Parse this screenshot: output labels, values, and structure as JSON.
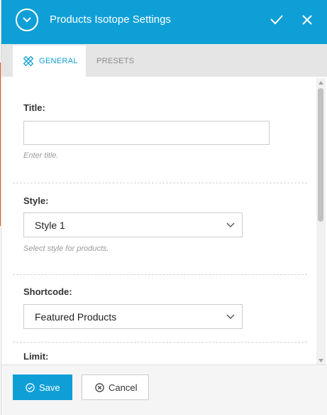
{
  "modal": {
    "title": "Products Isotope Settings",
    "accent_color": "#0f9fd7"
  },
  "tabs": [
    {
      "label": "GENERAL",
      "active": true,
      "icon": "pencil-ruler-icon"
    },
    {
      "label": "PRESETS",
      "active": false
    }
  ],
  "fields": {
    "title": {
      "label": "Title:",
      "value": "",
      "help": "Enter title."
    },
    "style": {
      "label": "Style:",
      "selected": "Style 1",
      "help": "Select style for products."
    },
    "shortcode": {
      "label": "Shortcode:",
      "selected": "Featured Products"
    },
    "limit": {
      "label": "Limit:"
    }
  },
  "footer": {
    "save_label": "Save",
    "cancel_label": "Cancel"
  }
}
